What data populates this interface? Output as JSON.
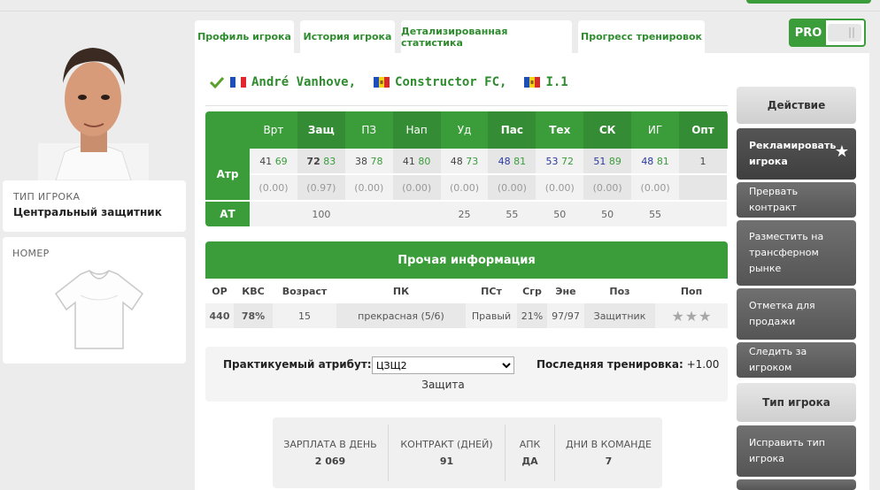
{
  "player": {
    "type_label": "ТИП ИГРОКА",
    "type_value": "Центральный защитник",
    "number_label": "НОМЕР",
    "name": "André Vanhove,",
    "club": "Constructor FC,",
    "league": "I.1"
  },
  "tabs": [
    "Профиль игрока",
    "История игрока",
    "Детализированная статистика",
    "Прогресс тренировок"
  ],
  "pro_label": "PRO",
  "attributes": {
    "headers": [
      "Врт",
      "Защ",
      "ПЗ",
      "Нап",
      "Уд",
      "Пас",
      "Тех",
      "СК",
      "ИГ",
      "Опт"
    ],
    "row_labels": {
      "atr": "Атр",
      "at": "АТ"
    },
    "values": [
      "41",
      "72",
      "38",
      "41",
      "48",
      "48",
      "53",
      "51",
      "48",
      "1"
    ],
    "potentials": [
      "69",
      "83",
      "78",
      "80",
      "73",
      "81",
      "72",
      "89",
      "81",
      ""
    ],
    "changes": [
      "(0.00)",
      "(0.97)",
      "(0.00)",
      "(0.00)",
      "(0.00)",
      "(0.00)",
      "(0.00)",
      "(0.00)",
      "(0.00)",
      ""
    ],
    "at": [
      "",
      "100",
      "",
      "",
      "25",
      "55",
      "50",
      "50",
      "55",
      ""
    ]
  },
  "other_info": {
    "title": "Прочая информация",
    "headers": [
      "ОР",
      "КВС",
      "Возраст",
      "ПК",
      "ПСт",
      "Сгр",
      "Эне",
      "Поз",
      "Поп"
    ],
    "values": [
      "440",
      "78%",
      "15",
      "прекрасная (5/6)",
      "Правый",
      "21%",
      "97/97",
      "Защитник",
      ""
    ]
  },
  "practice": {
    "label": "Практикуемый атрибут:",
    "selected": "ЦЗЩ2",
    "sub": "Защита",
    "last_label": "Последняя тренировка:",
    "last_value": "+1.00"
  },
  "contract": [
    {
      "label": "ЗАРПЛАТА В ДЕНЬ",
      "value": "2 069"
    },
    {
      "label": "КОНТРАКТ (ДНЕЙ)",
      "value": "91"
    },
    {
      "label": "АПК",
      "value": "ДА"
    },
    {
      "label": "ДНИ В КОМАНДЕ",
      "value": "7"
    }
  ],
  "actions": {
    "header": "Действие",
    "advertise": "Рекламировать игрока",
    "terminate": "Прервать контракт",
    "transfer": "Разместить на трансферном рынке",
    "mark_sale": "Отметка для продажи",
    "follow": "Следить за игроком",
    "type_header": "Тип игрока",
    "fix_type": "Исправить тип игрока"
  }
}
